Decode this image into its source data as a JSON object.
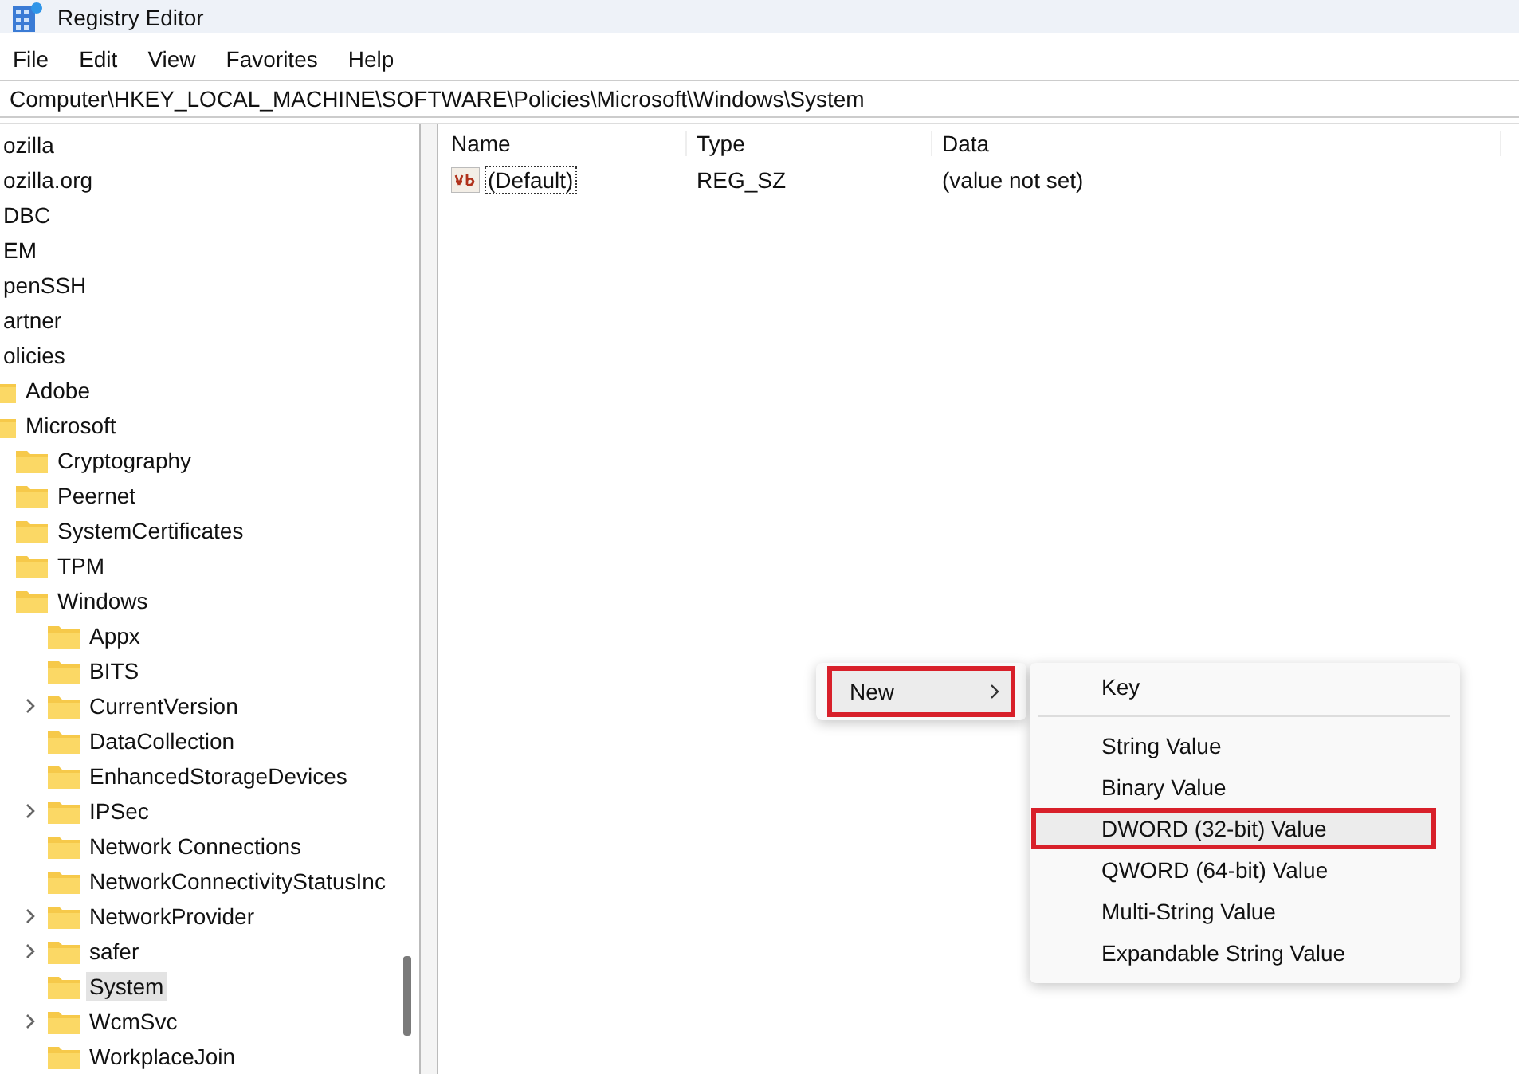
{
  "window": {
    "title": "Registry Editor"
  },
  "menu_bar": [
    "File",
    "Edit",
    "View",
    "Favorites",
    "Help"
  ],
  "address": "Computer\\HKEY_LOCAL_MACHINE\\SOFTWARE\\Policies\\Microsoft\\Windows\\System",
  "tree": [
    {
      "label": "ozilla",
      "selected": false
    },
    {
      "label": "ozilla.org",
      "selected": false
    },
    {
      "label": "DBC",
      "selected": false
    },
    {
      "label": "EM",
      "selected": false
    },
    {
      "label": "penSSH",
      "selected": false
    },
    {
      "label": "artner",
      "selected": false
    },
    {
      "label": "olicies",
      "selected": false,
      "children": [
        {
          "label": "Adobe",
          "selected": false
        },
        {
          "label": "Microsoft",
          "selected": false,
          "children": [
            {
              "label": "Cryptography",
              "selected": false,
              "expandable": false
            },
            {
              "label": "Peernet",
              "selected": false,
              "expandable": false
            },
            {
              "label": "SystemCertificates",
              "selected": false,
              "expandable": false
            },
            {
              "label": "TPM",
              "selected": false,
              "expandable": false
            },
            {
              "label": "Windows",
              "selected": false,
              "expandable": false,
              "children": [
                {
                  "label": "Appx",
                  "selected": false,
                  "expandable": false
                },
                {
                  "label": "BITS",
                  "selected": false,
                  "expandable": false
                },
                {
                  "label": "CurrentVersion",
                  "selected": false,
                  "expandable": true
                },
                {
                  "label": "DataCollection",
                  "selected": false,
                  "expandable": false
                },
                {
                  "label": "EnhancedStorageDevices",
                  "selected": false,
                  "expandable": false
                },
                {
                  "label": "IPSec",
                  "selected": false,
                  "expandable": true
                },
                {
                  "label": "Network Connections",
                  "selected": false,
                  "expandable": false
                },
                {
                  "label": "NetworkConnectivityStatusInc",
                  "selected": false,
                  "expandable": false
                },
                {
                  "label": "NetworkProvider",
                  "selected": false,
                  "expandable": true
                },
                {
                  "label": "safer",
                  "selected": false,
                  "expandable": true
                },
                {
                  "label": "System",
                  "selected": true,
                  "expandable": false
                },
                {
                  "label": "WcmSvc",
                  "selected": false,
                  "expandable": true
                },
                {
                  "label": "WorkplaceJoin",
                  "selected": false,
                  "expandable": false
                }
              ]
            }
          ]
        }
      ]
    }
  ],
  "values": {
    "columns": [
      "Name",
      "Type",
      "Data"
    ],
    "rows": [
      {
        "name": "(Default)",
        "type": "REG_SZ",
        "data": "(value not set)",
        "focused": true
      }
    ]
  },
  "context_menu": {
    "items": [
      {
        "label": "New",
        "submenu": true,
        "highlighted": true
      }
    ]
  },
  "submenu": {
    "items": [
      {
        "kind": "item",
        "label": "Key",
        "highlighted": false
      },
      {
        "kind": "separator"
      },
      {
        "kind": "item",
        "label": "String Value",
        "highlighted": false
      },
      {
        "kind": "item",
        "label": "Binary Value",
        "highlighted": false
      },
      {
        "kind": "item",
        "label": "DWORD (32-bit) Value",
        "highlighted": true
      },
      {
        "kind": "item",
        "label": "QWORD (64-bit) Value",
        "highlighted": false
      },
      {
        "kind": "item",
        "label": "Multi-String Value",
        "highlighted": false
      },
      {
        "kind": "item",
        "label": "Expandable String Value",
        "highlighted": false
      }
    ]
  }
}
